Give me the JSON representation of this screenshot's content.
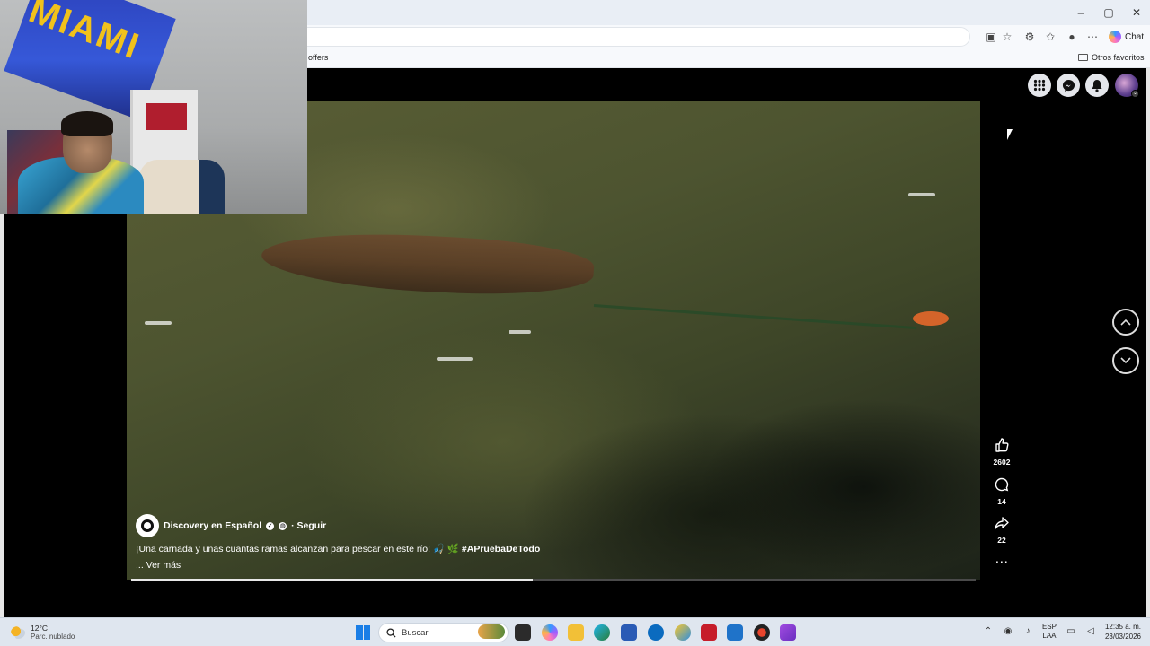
{
  "browser": {
    "chat_label": "Chat",
    "bookmark_offers": "offers",
    "bookmark_other_favorites": "Otros favoritos"
  },
  "window_controls": {
    "minimize": "–",
    "maximize": "▢",
    "close": "✕"
  },
  "video": {
    "channel_name": "Discovery en Español",
    "follow_label": "· Seguir",
    "caption": "¡Una carnada y unas cuantas ramas alcanzan para pescar en este río! 🎣 🌿",
    "hashtag": "#APruebaDeTodo",
    "see_more": "... Ver más",
    "progress": 0.476,
    "likes": "2602",
    "comments": "14",
    "shares": "22"
  },
  "webcam": {
    "banner_text": "MIAMI"
  },
  "taskbar": {
    "temperature": "12°C",
    "weather_desc": "Parc. nublado",
    "search_placeholder": "Buscar",
    "lang_top": "ESP",
    "lang_bottom": "LAA",
    "time": "12:35 a. m.",
    "date": "23/03/2026"
  },
  "colors": {
    "page_bg": "#000000",
    "taskbar_bg": "#dfe6ef",
    "accent_blue": "#1a7ee6"
  },
  "icons": [
    "apps-grid-icon",
    "messenger-icon",
    "bell-icon",
    "like-icon",
    "comment-icon",
    "share-icon",
    "more-icon",
    "chevron-up-icon",
    "chevron-down-icon",
    "search-icon",
    "windows-start-icon"
  ]
}
